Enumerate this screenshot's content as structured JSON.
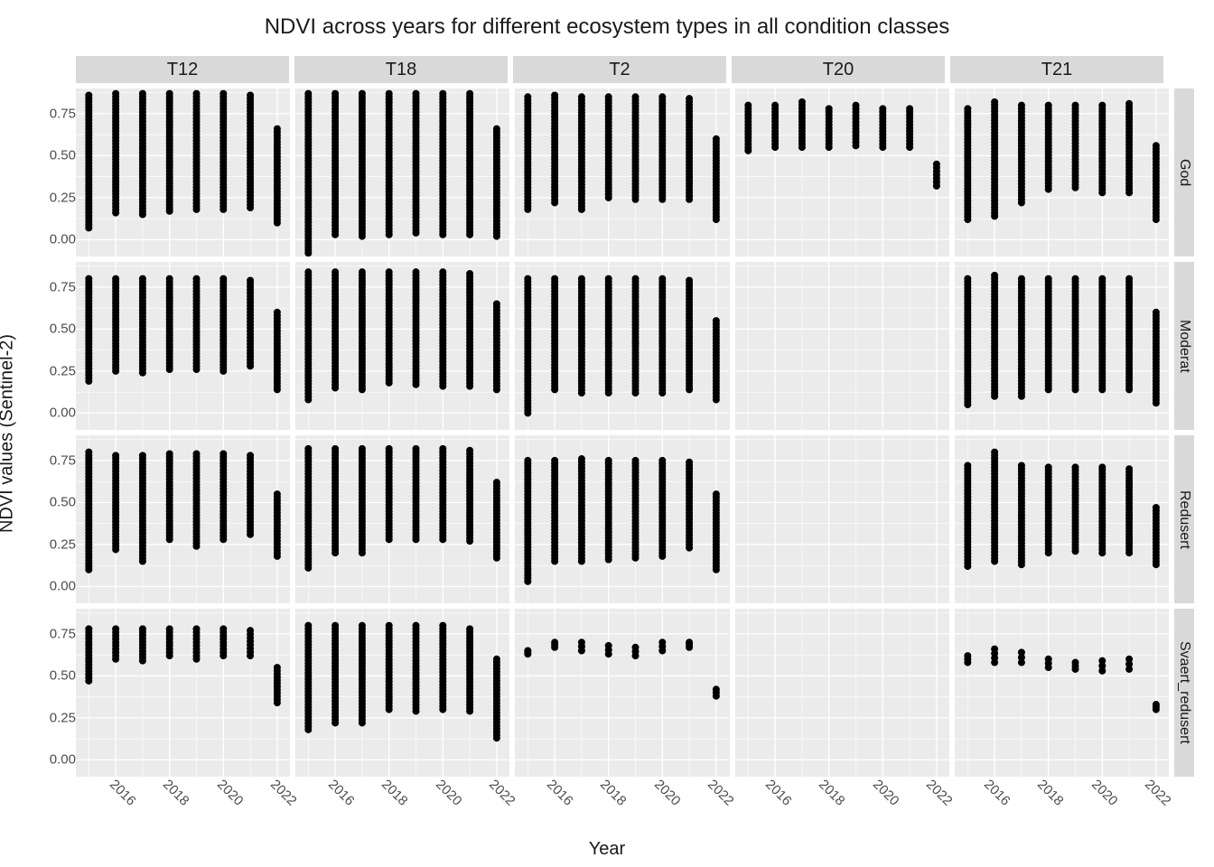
{
  "chart_data": {
    "type": "scatter",
    "title": "NDVI across years for different ecosystem types in all condition classes",
    "xlabel": "Year",
    "ylabel": "NDVI values (Sentinel-2)",
    "facets": {
      "cols": [
        "T12",
        "T18",
        "T2",
        "T20",
        "T21"
      ],
      "rows": [
        "God",
        "Moderat",
        "Redusert",
        "Svaert_redusert"
      ]
    },
    "x_ticks": [
      2016,
      2018,
      2020,
      2022
    ],
    "y_ticks": [
      0.0,
      0.25,
      0.5,
      0.75
    ],
    "xlim": [
      2015,
      2022
    ],
    "ylim_rows": {
      "God": [
        -0.1,
        0.9
      ],
      "Moderat": [
        -0.1,
        0.9
      ],
      "Redusert": [
        -0.1,
        0.9
      ],
      "Svaert_redusert": [
        -0.1,
        0.9
      ]
    },
    "panel_ranges": {
      "T12": {
        "God": {
          "2015": [
            0.07,
            0.86
          ],
          "2016": [
            0.16,
            0.87
          ],
          "2017": [
            0.15,
            0.87
          ],
          "2018": [
            0.17,
            0.87
          ],
          "2019": [
            0.18,
            0.87
          ],
          "2020": [
            0.18,
            0.87
          ],
          "2021": [
            0.19,
            0.86
          ],
          "2022": [
            0.1,
            0.66
          ]
        },
        "Moderat": {
          "2015": [
            0.19,
            0.8
          ],
          "2016": [
            0.25,
            0.8
          ],
          "2017": [
            0.24,
            0.8
          ],
          "2018": [
            0.26,
            0.8
          ],
          "2019": [
            0.26,
            0.8
          ],
          "2020": [
            0.25,
            0.8
          ],
          "2021": [
            0.28,
            0.79
          ],
          "2022": [
            0.14,
            0.6
          ]
        },
        "Redusert": {
          "2015": [
            0.1,
            0.8
          ],
          "2016": [
            0.22,
            0.78
          ],
          "2017": [
            0.15,
            0.78
          ],
          "2018": [
            0.28,
            0.79
          ],
          "2019": [
            0.24,
            0.79
          ],
          "2020": [
            0.28,
            0.79
          ],
          "2021": [
            0.31,
            0.78
          ],
          "2022": [
            0.18,
            0.55
          ]
        },
        "Svaert_redusert": {
          "2015": [
            0.47,
            0.78
          ],
          "2016": [
            0.6,
            0.78
          ],
          "2017": [
            0.59,
            0.78
          ],
          "2018": [
            0.62,
            0.78
          ],
          "2019": [
            0.6,
            0.78
          ],
          "2020": [
            0.62,
            0.78
          ],
          "2021": [
            0.62,
            0.77
          ],
          "2022": [
            0.34,
            0.55
          ]
        }
      },
      "T18": {
        "God": {
          "2015": [
            -0.08,
            0.87
          ],
          "2016": [
            0.03,
            0.87
          ],
          "2017": [
            0.02,
            0.87
          ],
          "2018": [
            0.03,
            0.87
          ],
          "2019": [
            0.04,
            0.87
          ],
          "2020": [
            0.03,
            0.87
          ],
          "2021": [
            0.03,
            0.87
          ],
          "2022": [
            0.02,
            0.66
          ]
        },
        "Moderat": {
          "2015": [
            0.08,
            0.84
          ],
          "2016": [
            0.15,
            0.84
          ],
          "2017": [
            0.14,
            0.84
          ],
          "2018": [
            0.18,
            0.84
          ],
          "2019": [
            0.17,
            0.84
          ],
          "2020": [
            0.16,
            0.84
          ],
          "2021": [
            0.16,
            0.83
          ],
          "2022": [
            0.14,
            0.65
          ]
        },
        "Redusert": {
          "2015": [
            0.11,
            0.82
          ],
          "2016": [
            0.2,
            0.82
          ],
          "2017": [
            0.2,
            0.82
          ],
          "2018": [
            0.28,
            0.82
          ],
          "2019": [
            0.28,
            0.82
          ],
          "2020": [
            0.28,
            0.82
          ],
          "2021": [
            0.27,
            0.81
          ],
          "2022": [
            0.17,
            0.62
          ]
        },
        "Svaert_redusert": {
          "2015": [
            0.18,
            0.8
          ],
          "2016": [
            0.22,
            0.8
          ],
          "2017": [
            0.22,
            0.8
          ],
          "2018": [
            0.3,
            0.8
          ],
          "2019": [
            0.29,
            0.8
          ],
          "2020": [
            0.3,
            0.8
          ],
          "2021": [
            0.29,
            0.78
          ],
          "2022": [
            0.13,
            0.6
          ]
        }
      },
      "T2": {
        "God": {
          "2015": [
            0.18,
            0.85
          ],
          "2016": [
            0.22,
            0.86
          ],
          "2017": [
            0.18,
            0.85
          ],
          "2018": [
            0.25,
            0.85
          ],
          "2019": [
            0.24,
            0.85
          ],
          "2020": [
            0.24,
            0.85
          ],
          "2021": [
            0.24,
            0.84
          ],
          "2022": [
            0.12,
            0.6
          ]
        },
        "Moderat": {
          "2015": [
            0.0,
            0.8
          ],
          "2016": [
            0.14,
            0.8
          ],
          "2017": [
            0.12,
            0.8
          ],
          "2018": [
            0.12,
            0.8
          ],
          "2019": [
            0.12,
            0.8
          ],
          "2020": [
            0.12,
            0.8
          ],
          "2021": [
            0.14,
            0.79
          ],
          "2022": [
            0.08,
            0.55
          ]
        },
        "Redusert": {
          "2015": [
            0.03,
            0.75
          ],
          "2016": [
            0.15,
            0.75
          ],
          "2017": [
            0.15,
            0.76
          ],
          "2018": [
            0.16,
            0.75
          ],
          "2019": [
            0.17,
            0.75
          ],
          "2020": [
            0.18,
            0.75
          ],
          "2021": [
            0.23,
            0.74
          ],
          "2022": [
            0.1,
            0.55
          ]
        },
        "Svaert_redusert": {
          "2015": [
            0.63,
            0.65
          ],
          "2016": [
            0.67,
            0.7
          ],
          "2017": [
            0.65,
            0.7
          ],
          "2018": [
            0.63,
            0.68
          ],
          "2019": [
            0.62,
            0.67
          ],
          "2020": [
            0.65,
            0.7
          ],
          "2021": [
            0.67,
            0.7
          ],
          "2022": [
            0.38,
            0.42
          ]
        }
      },
      "T20": {
        "God": {
          "2015": [
            0.53,
            0.8
          ],
          "2016": [
            0.55,
            0.8
          ],
          "2017": [
            0.55,
            0.82
          ],
          "2018": [
            0.55,
            0.78
          ],
          "2019": [
            0.56,
            0.8
          ],
          "2020": [
            0.55,
            0.78
          ],
          "2021": [
            0.55,
            0.78
          ],
          "2022": [
            0.32,
            0.45
          ]
        }
      },
      "T21": {
        "God": {
          "2015": [
            0.12,
            0.78
          ],
          "2016": [
            0.14,
            0.82
          ],
          "2017": [
            0.22,
            0.8
          ],
          "2018": [
            0.3,
            0.8
          ],
          "2019": [
            0.31,
            0.8
          ],
          "2020": [
            0.28,
            0.8
          ],
          "2021": [
            0.28,
            0.81
          ],
          "2022": [
            0.12,
            0.56
          ]
        },
        "Moderat": {
          "2015": [
            0.05,
            0.8
          ],
          "2016": [
            0.1,
            0.82
          ],
          "2017": [
            0.1,
            0.8
          ],
          "2018": [
            0.14,
            0.8
          ],
          "2019": [
            0.14,
            0.8
          ],
          "2020": [
            0.14,
            0.8
          ],
          "2021": [
            0.14,
            0.8
          ],
          "2022": [
            0.06,
            0.6
          ]
        },
        "Redusert": {
          "2015": [
            0.12,
            0.72
          ],
          "2016": [
            0.15,
            0.8
          ],
          "2017": [
            0.13,
            0.72
          ],
          "2018": [
            0.2,
            0.71
          ],
          "2019": [
            0.21,
            0.71
          ],
          "2020": [
            0.2,
            0.71
          ],
          "2021": [
            0.2,
            0.7
          ],
          "2022": [
            0.13,
            0.47
          ]
        },
        "Svaert_redusert": {
          "2015": [
            0.58,
            0.62
          ],
          "2016": [
            0.58,
            0.66
          ],
          "2017": [
            0.58,
            0.64
          ],
          "2018": [
            0.55,
            0.6
          ],
          "2019": [
            0.54,
            0.58
          ],
          "2020": [
            0.53,
            0.59
          ],
          "2021": [
            0.54,
            0.6
          ],
          "2022": [
            0.3,
            0.33
          ]
        }
      }
    }
  }
}
